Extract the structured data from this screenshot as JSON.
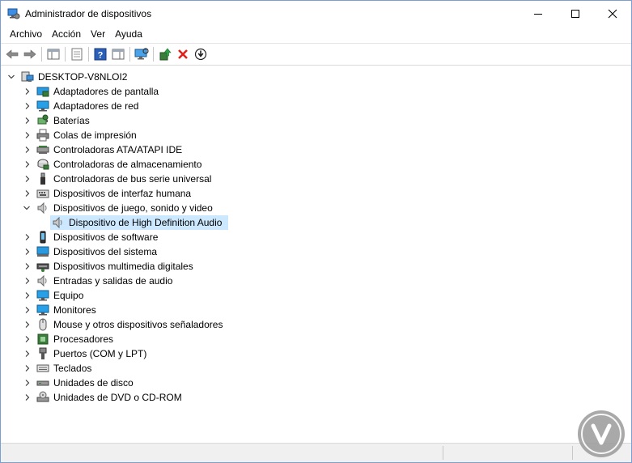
{
  "window": {
    "title": "Administrador de dispositivos"
  },
  "menu": {
    "items": [
      "Archivo",
      "Acción",
      "Ver",
      "Ayuda"
    ]
  },
  "toolbar": {
    "buttons": [
      "back-icon",
      "forward-icon",
      "properties-pane-icon",
      "list-icon",
      "help-icon",
      "action-pane-icon",
      "scan-monitor-icon",
      "update-driver-icon",
      "uninstall-icon",
      "download-icon"
    ]
  },
  "tree": {
    "root": "DESKTOP-V8NLOI2",
    "categories": [
      {
        "label": "Adaptadores de pantalla",
        "icon": "display-adapter-icon"
      },
      {
        "label": "Adaptadores de red",
        "icon": "network-adapter-icon"
      },
      {
        "label": "Baterías",
        "icon": "battery-icon"
      },
      {
        "label": "Colas de impresión",
        "icon": "printer-icon"
      },
      {
        "label": "Controladoras ATA/ATAPI IDE",
        "icon": "ide-controller-icon"
      },
      {
        "label": "Controladoras de almacenamiento",
        "icon": "storage-controller-icon"
      },
      {
        "label": "Controladoras de bus serie universal",
        "icon": "usb-icon"
      },
      {
        "label": "Dispositivos de interfaz humana",
        "icon": "hid-icon"
      },
      {
        "label": "Dispositivos de juego, sonido y video",
        "icon": "speaker-icon",
        "expanded": true,
        "children": [
          {
            "label": "Dispositivo de High Definition Audio",
            "icon": "speaker-icon",
            "selected": true
          }
        ]
      },
      {
        "label": "Dispositivos de software",
        "icon": "software-device-icon"
      },
      {
        "label": "Dispositivos del sistema",
        "icon": "system-device-icon"
      },
      {
        "label": "Dispositivos multimedia digitales",
        "icon": "multimedia-icon"
      },
      {
        "label": "Entradas y salidas de audio",
        "icon": "audio-io-icon"
      },
      {
        "label": "Equipo",
        "icon": "computer-icon"
      },
      {
        "label": "Monitores",
        "icon": "monitor-icon"
      },
      {
        "label": "Mouse y otros dispositivos señaladores",
        "icon": "mouse-icon"
      },
      {
        "label": "Procesadores",
        "icon": "processor-icon"
      },
      {
        "label": "Puertos (COM y LPT)",
        "icon": "port-icon"
      },
      {
        "label": "Teclados",
        "icon": "keyboard-icon"
      },
      {
        "label": "Unidades de disco",
        "icon": "disk-drive-icon"
      },
      {
        "label": "Unidades de DVD o CD-ROM",
        "icon": "dvd-icon"
      }
    ]
  },
  "colors": {
    "selection": "#cce8ff",
    "window_border": "#7a9fd4"
  }
}
